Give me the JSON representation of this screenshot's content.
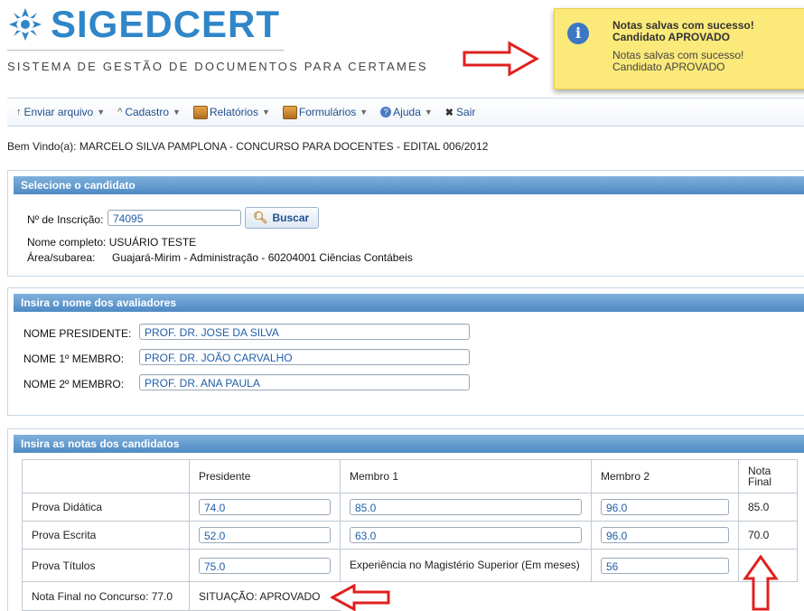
{
  "header": {
    "logo_text": "SIGEDCERT",
    "subtitle": "SISTEMA DE GESTÃO DE DOCUMENTOS PARA CERTAMES",
    "brand_color": "#2f86c8"
  },
  "toast": {
    "title_line1": "Notas salvas com sucesso!",
    "title_line2": "Candidato APROVADO",
    "body_line1": "Notas salvas com sucesso!",
    "body_line2": "Candidato APROVADO",
    "icon": "info-icon",
    "bg_color": "#fbe979"
  },
  "menu": {
    "items": [
      {
        "label": "Enviar arquivo",
        "icon": "upload-arrow-icon"
      },
      {
        "label": "Cadastro",
        "icon": "caret-up-icon"
      },
      {
        "label": "Relatórios",
        "icon": "image-icon"
      },
      {
        "label": "Formulários",
        "icon": "image-icon"
      },
      {
        "label": "Ajuda",
        "icon": "help-icon"
      },
      {
        "label": "Sair",
        "icon": "close-icon"
      }
    ]
  },
  "welcome": "Bem Vindo(a): MARCELO SILVA PAMPLONA - CONCURSO PARA DOCENTES - EDITAL 006/2012",
  "candidate_panel": {
    "title": "Selecione o candidato",
    "inscricao_label": "Nº de Inscrição:",
    "inscricao_value": "74095",
    "search_button": "Buscar",
    "nome_line": "Nome completo: USUÁRIO TESTE",
    "area_label": "Área/subarea:",
    "area_value": "Guajará-Mirim - Administração - 60204001 Ciências Contábeis"
  },
  "evaluators_panel": {
    "title": "Insira o nome dos avaliadores",
    "presidente_label": "NOME PRESIDENTE:",
    "presidente_value": "PROF. DR. JOSE DA SILVA",
    "membro1_label": "NOME 1º MEMBRO:",
    "membro1_value": "PROF. DR. JOÃO CARVALHO",
    "membro2_label": "NOME 2º MEMBRO:",
    "membro2_value": "PROF. DR. ANA PAULA"
  },
  "grades_panel": {
    "title": "Insira as notas dos candidatos",
    "headers": [
      "",
      "Presidente",
      "Membro 1",
      "Membro 2",
      "Nota Final"
    ],
    "rows": [
      {
        "label": "Prova Didática",
        "presidente": "74.0",
        "membro1": "85.0",
        "membro2": "96.0",
        "final": "85.0"
      },
      {
        "label": "Prova Escrita",
        "presidente": "52.0",
        "membro1": "63.0",
        "membro2": "96.0",
        "final": "70.0"
      },
      {
        "label": "Prova Títulos",
        "presidente": "75.0",
        "membro1_text": "Experiência no Magistério Superior (Em meses)",
        "membro2": "56",
        "final": ""
      }
    ],
    "final_label": "Nota Final no Concurso: 77.0",
    "situacao": "SITUAÇÃO: APROVADO"
  },
  "annotation_color": "#e02020"
}
